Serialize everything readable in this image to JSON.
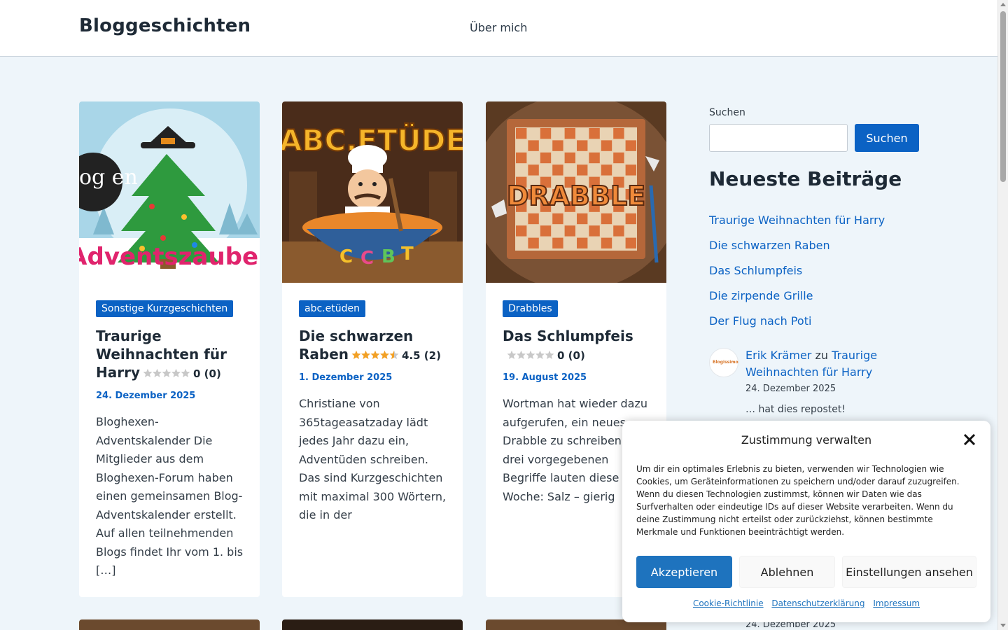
{
  "header": {
    "site_title": "Bloggeschichten",
    "nav": [
      {
        "label": "Über mich"
      }
    ]
  },
  "posts": [
    {
      "category": "Sonstige Kurzgeschichten",
      "title": "Traurige Weihnachten für Harry",
      "rating_value": 0,
      "rating_text": "0 (0)",
      "date": "24. Dezember 2025",
      "excerpt": "Bloghexen-Adventskalender Die Mitglieder aus dem Bloghexen-Forum haben einen gemeinsamen Blog-Adventskalender erstellt. Auf allen teilnehmenden Blogs findet Ihr vom 1. bis […]",
      "image_caption": "Adventszauber",
      "image_badge": "og en"
    },
    {
      "category": "abc.etüden",
      "title": "Die schwarzen Raben",
      "rating_value": 4.5,
      "rating_text": "4.5 (2)",
      "date": "1. Dezember 2025",
      "excerpt": "Christiane von 365tageasatzaday lädt jedes Jahr dazu ein, Adventüden schreiben. Das sind Kurzgeschichten mit maximal 300 Wörtern, die in der",
      "image_caption": "ABC.ETÜDE"
    },
    {
      "category": "Drabbles",
      "title": "Das Schlumpfeis",
      "rating_value": 0,
      "rating_text": "0 (0)",
      "date": "19. August 2025",
      "excerpt": "Wortman hat wieder dazu aufgerufen, ein neues Drabble zu schreiben. Die drei vorgegebenen Begriffe lauten diese Woche: Salz – gierig",
      "image_caption": "DRABBLE"
    }
  ],
  "sidebar": {
    "search_label": "Suchen",
    "search_placeholder": "",
    "search_button": "Suchen",
    "recent_title": "Neueste Beiträge",
    "recent_posts": [
      "Traurige Weihnachten für Harry",
      "Die schwarzen Raben",
      "Das Schlumpfeis",
      "Die zirpende Grille",
      "Der Flug nach Poti"
    ],
    "comment": {
      "avatar_label": "Blogissimo",
      "author": "Erik Krämer",
      "connector": "zu",
      "post": "Traurige Weihnachten für Harry",
      "date": "24. Dezember 2025",
      "snippet": "… hat dies repostet!",
      "next_date": "24. Dezember 2025"
    }
  },
  "consent": {
    "title": "Zustimmung verwalten",
    "body": "Um dir ein optimales Erlebnis zu bieten, verwenden wir Technologien wie Cookies, um Geräteinformationen zu speichern und/oder darauf zuzugreifen. Wenn du diesen Technologien zustimmst, können wir Daten wie das Surfverhalten oder eindeutige IDs auf dieser Website verarbeiten. Wenn du deine Zustimmung nicht erteilst oder zurückziehst, können bestimmte Merkmale und Funktionen beeinträchtigt werden.",
    "accept": "Akzeptieren",
    "deny": "Ablehnen",
    "preferences": "Einstellungen ansehen",
    "links": [
      "Cookie-Richtlinie",
      "Datenschutzerklärung",
      "Impressum"
    ]
  },
  "colors": {
    "accent": "#0b62c4",
    "background": "#eef5fa",
    "consent_button": "#1e73be",
    "star_filled": "#f2a024",
    "star_empty": "#c8c8c8"
  }
}
